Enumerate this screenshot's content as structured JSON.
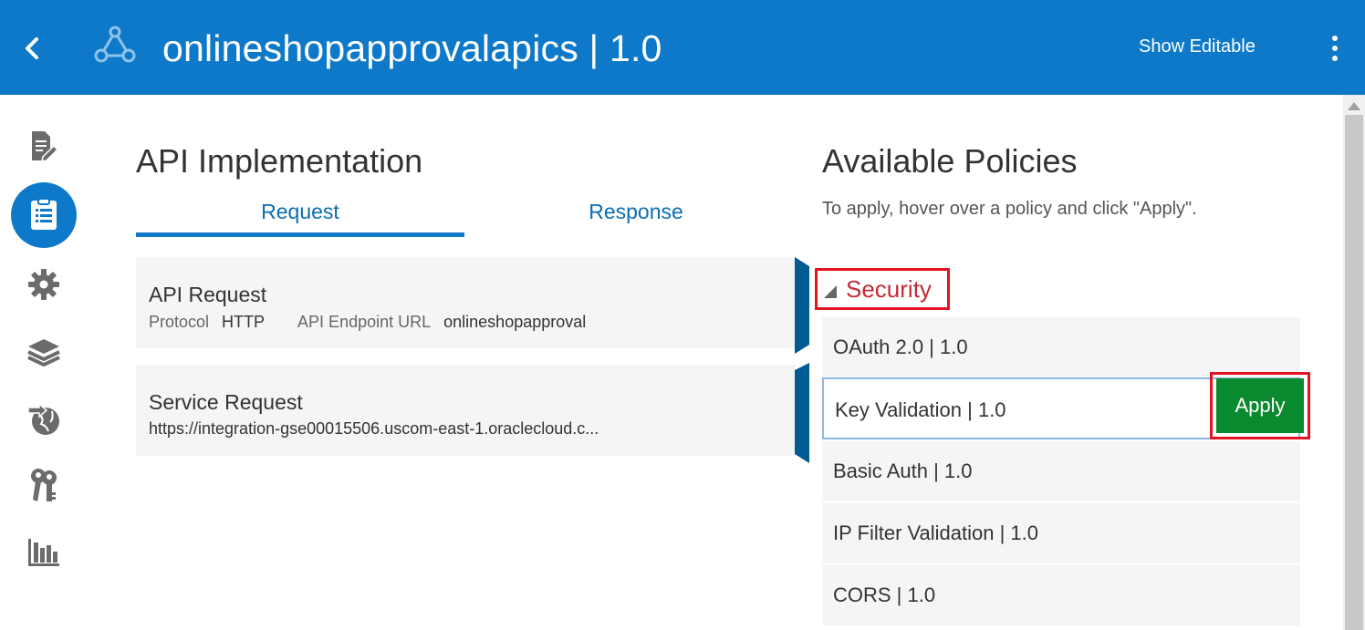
{
  "header": {
    "title": "onlineshopapprovalapics | 1.0",
    "show_editable": "Show Editable",
    "back_icon": "chevron-left-icon",
    "api_icon": "api-network-icon",
    "menu_icon": "kebab-menu-icon",
    "bg_color": "#0d79c8"
  },
  "sidebar": {
    "items": [
      {
        "name": "overview",
        "icon": "document-edit-icon",
        "active": false
      },
      {
        "name": "api-implementation",
        "icon": "list-icon",
        "active": true
      },
      {
        "name": "deployments",
        "icon": "gear-icon",
        "active": false
      },
      {
        "name": "layers",
        "icon": "layers-icon",
        "active": false
      },
      {
        "name": "publication",
        "icon": "globe-arrow-icon",
        "active": false
      },
      {
        "name": "grants",
        "icon": "keys-icon",
        "active": false
      },
      {
        "name": "analytics",
        "icon": "bar-chart-icon",
        "active": false
      }
    ]
  },
  "implementation": {
    "title": "API Implementation",
    "tabs": [
      {
        "label": "Request",
        "active": true
      },
      {
        "label": "Response",
        "active": false
      }
    ],
    "api_request": {
      "title": "API Request",
      "protocol_label": "Protocol",
      "protocol_value": "HTTP",
      "endpoint_label": "API Endpoint URL",
      "endpoint_value": "onlineshopapproval"
    },
    "service_request": {
      "title": "Service Request",
      "url": "https://integration-gse00015506.uscom-east-1.oraclecloud.c..."
    }
  },
  "policies": {
    "title": "Available Policies",
    "hint": "To apply, hover over a policy and click \"Apply\".",
    "section": "Security",
    "items": [
      {
        "label": "OAuth 2.0 | 1.0"
      },
      {
        "label": "Key Validation | 1.0",
        "hovered": true
      },
      {
        "label": "Basic Auth | 1.0"
      },
      {
        "label": "IP Filter Validation | 1.0"
      },
      {
        "label": "CORS | 1.0"
      }
    ],
    "apply_label": "Apply",
    "apply_color": "#0a8a2e",
    "highlight_color": "#e1141f"
  }
}
